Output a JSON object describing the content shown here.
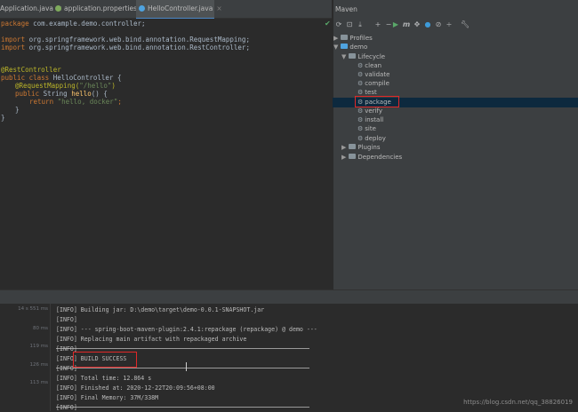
{
  "editor": {
    "tabs": [
      {
        "label": "Application.java",
        "color": "#4fa3df"
      },
      {
        "label": "application.properties",
        "color": "#7eaa5c"
      },
      {
        "label": "HelloController.java",
        "color": "#4fa3df"
      }
    ],
    "lines": {
      "l1_kw": "package",
      "l1_rest": " com.example.demo.controller;",
      "l3_kw": "import",
      "l3_rest": " org.springframework.web.bind.annotation.RequestMapping;",
      "l4_kw": "import",
      "l4_rest": " org.springframework.web.bind.annotation.RestController;",
      "l7_ann": "@RestController",
      "l8_kw": "public class",
      "l8_rest": " HelloController {",
      "l9_ann": "@RequestMapping(",
      "l9_str": "\"/hello\"",
      "l9_end": ")",
      "l10_kw": "public",
      "l10_type": " String ",
      "l10_fn": "hello",
      "l10_end": "() {",
      "l11_kw": "return",
      "l11_str": " \"hello, docker\"",
      "l11_end": ";",
      "l12": "}",
      "l13": "}"
    }
  },
  "maven": {
    "title": "Maven",
    "toolbar_icons": [
      "refresh-icon",
      "reimport-icon",
      "download-icon",
      "add-icon",
      "minus-icon",
      "run-icon",
      "maven-m-icon",
      "toggle-icon",
      "offline-icon",
      "skip-tests-icon",
      "collapse-icon",
      "settings-icon"
    ],
    "tree": {
      "profiles": "Profiles",
      "demo": "demo",
      "lifecycle": "Lifecycle",
      "goals": [
        "clean",
        "validate",
        "compile",
        "test",
        "package",
        "verify",
        "install",
        "site",
        "deploy"
      ],
      "plugins": "Plugins",
      "dependencies": "Dependencies"
    }
  },
  "console": {
    "times": [
      "14 s 551 ms",
      "80 ms",
      "119 ms",
      "126 ms",
      "113 ms"
    ],
    "lines": [
      "[INFO] Building jar: D:\\demo\\target\\demo-0.0.1-SNAPSHOT.jar",
      "[INFO]",
      "[INFO] --- spring-boot-maven-plugin:2.4.1:repackage (repackage) @ demo ---",
      "[INFO] Replacing main artifact with repackaged archive",
      "[INFO] ",
      "[INFO] BUILD SUCCESS",
      "[INFO] ",
      "[INFO] Total time: 12.864 s",
      "[INFO] Finished at: 2020-12-22T20:09:56+08:00",
      "[INFO] Final Memory: 37M/338M",
      "[INFO] "
    ]
  },
  "watermark": "https://blog.csdn.net/qq_38826019"
}
